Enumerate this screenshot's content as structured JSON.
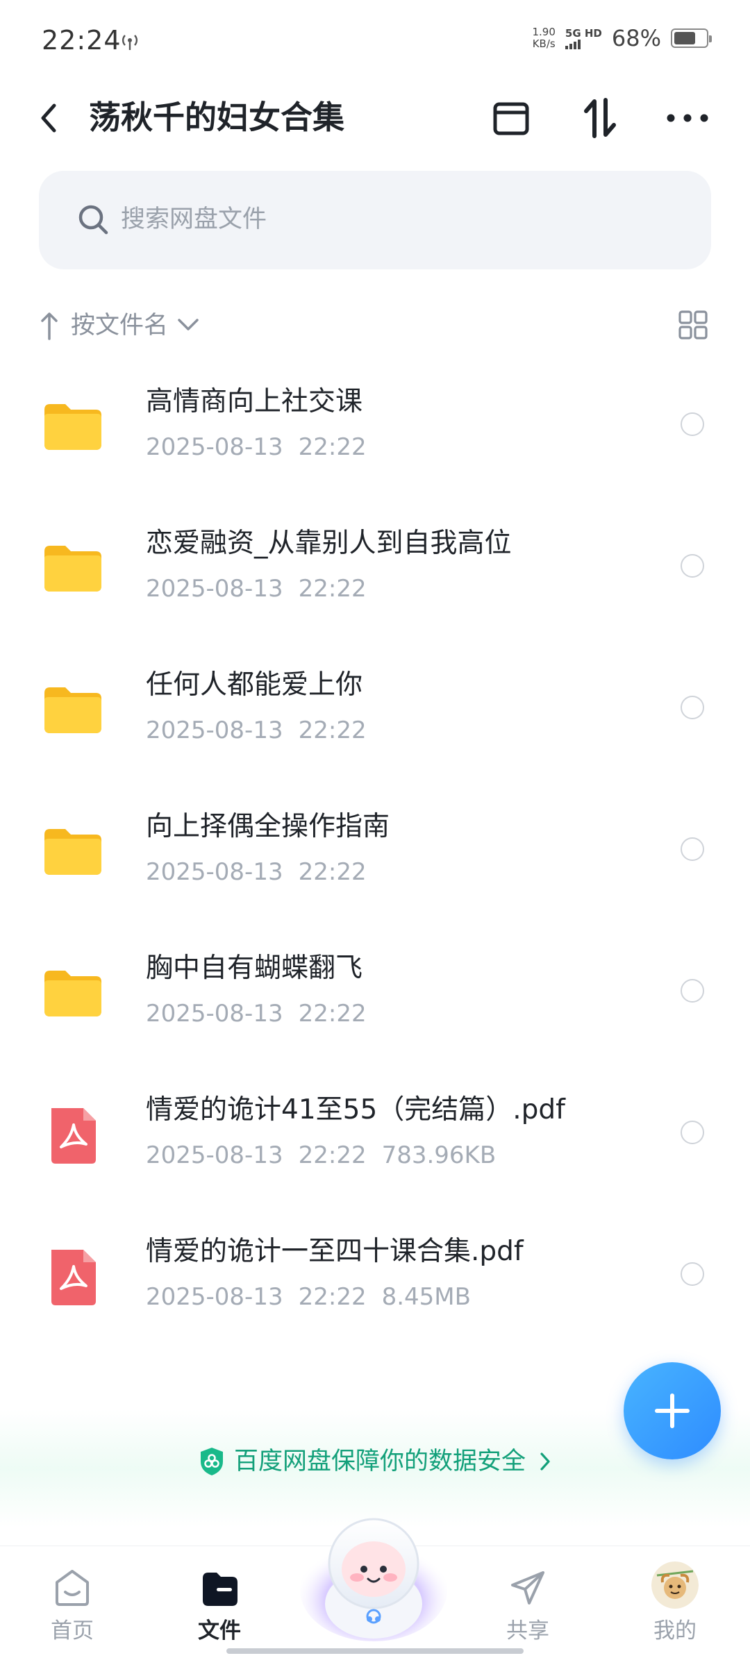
{
  "status_bar": {
    "time": "22:24",
    "net_speed_value": "1.90",
    "net_speed_unit": "KB/s",
    "network_type": "5G HD",
    "battery": "68%",
    "battery_level": 0.68
  },
  "header": {
    "title": "荡秋千的妇女合集"
  },
  "search": {
    "placeholder": "搜索网盘文件"
  },
  "sort": {
    "label": "按文件名"
  },
  "files": [
    {
      "name": "高情商向上社交课",
      "date": "2025-08-13",
      "time": "22:22",
      "size": "",
      "type": "folder"
    },
    {
      "name": "恋爱融资_从靠别人到自我高位",
      "date": "2025-08-13",
      "time": "22:22",
      "size": "",
      "type": "folder"
    },
    {
      "name": "任何人都能爱上你",
      "date": "2025-08-13",
      "time": "22:22",
      "size": "",
      "type": "folder"
    },
    {
      "name": "向上择偶全操作指南",
      "date": "2025-08-13",
      "time": "22:22",
      "size": "",
      "type": "folder"
    },
    {
      "name": "胸中自有蝴蝶翻飞",
      "date": "2025-08-13",
      "time": "22:22",
      "size": "",
      "type": "folder"
    },
    {
      "name": "情爱的诡计41至55（完结篇）.pdf",
      "date": "2025-08-13",
      "time": "22:22",
      "size": "783.96KB",
      "type": "pdf"
    },
    {
      "name": "情爱的诡计一至四十课合集.pdf",
      "date": "2025-08-13",
      "time": "22:22",
      "size": "8.45MB",
      "type": "pdf"
    }
  ],
  "banner": {
    "text": "百度网盘保障你的数据安全"
  },
  "bottom_nav": {
    "home": "首页",
    "files": "文件",
    "share": "共享",
    "mine": "我的"
  },
  "colors": {
    "folder": "#ffcc33",
    "pdf": "#f0636b",
    "accent": "#2e8cff",
    "security_green": "#13a07a"
  }
}
